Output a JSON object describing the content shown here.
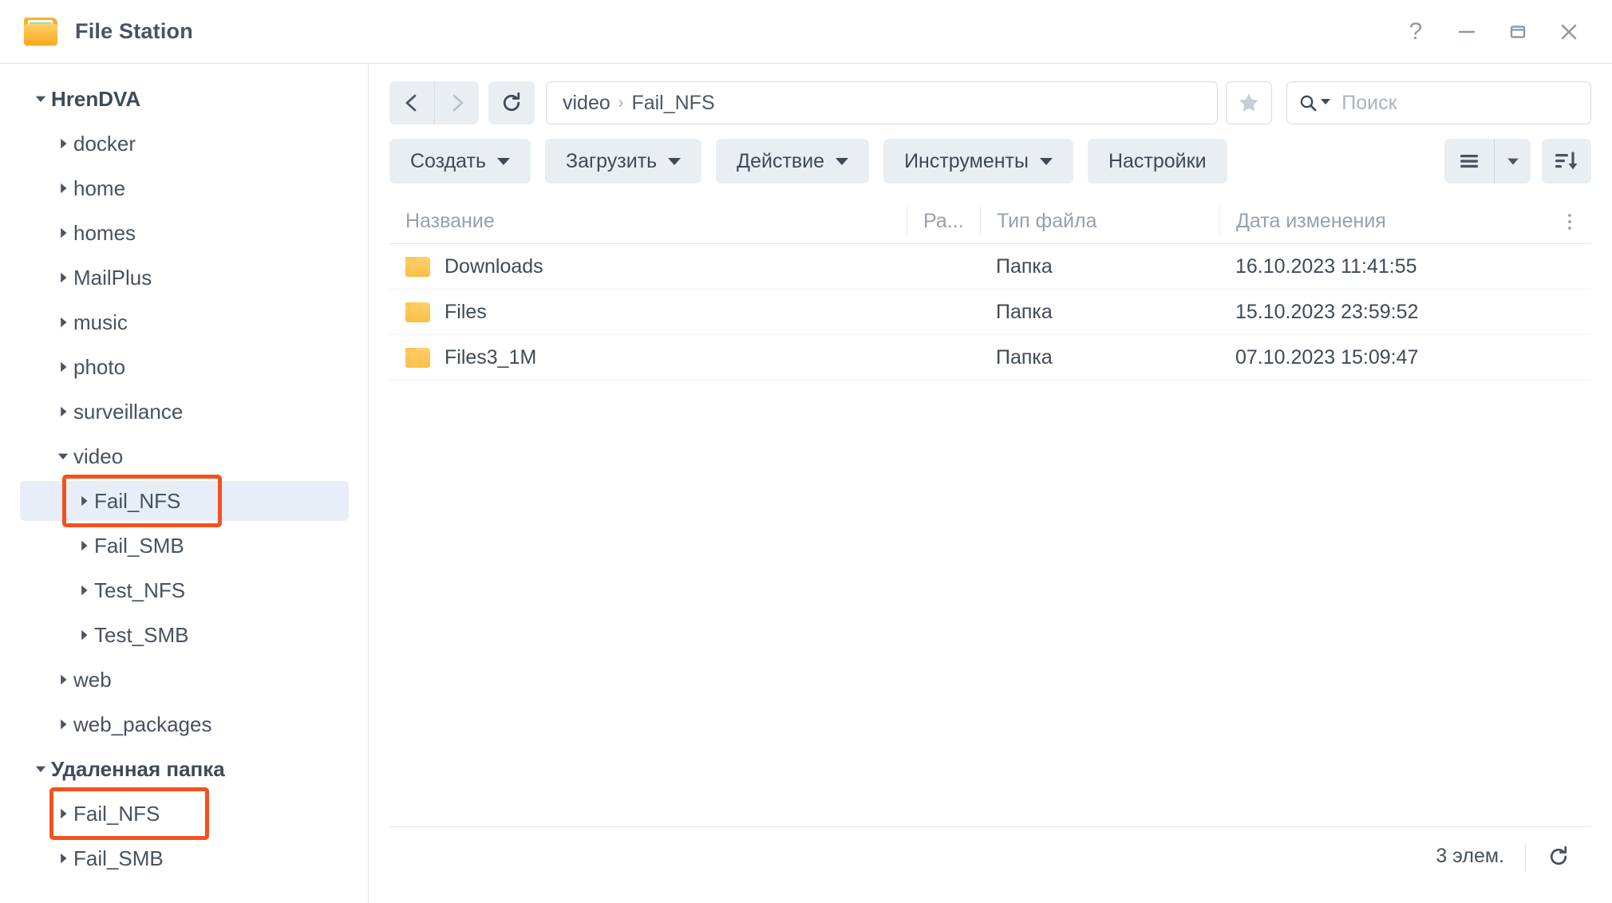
{
  "window": {
    "title": "File Station",
    "icon": "folder-icon",
    "controls": [
      {
        "name": "help-button",
        "glyph": "?"
      },
      {
        "name": "minimize-button",
        "glyph": "—"
      },
      {
        "name": "maximize-button",
        "glyph": "□"
      },
      {
        "name": "close-button",
        "glyph": "✕"
      }
    ]
  },
  "sidebar": {
    "items": [
      {
        "label": "HrenDVA",
        "level": 0,
        "expanded": true,
        "caret": "caret-down",
        "bold": true,
        "selected": false,
        "annotated": false
      },
      {
        "label": "docker",
        "level": 1,
        "expanded": false,
        "caret": "caret-right",
        "bold": false,
        "selected": false,
        "annotated": false
      },
      {
        "label": "home",
        "level": 1,
        "expanded": false,
        "caret": "caret-right",
        "bold": false,
        "selected": false,
        "annotated": false
      },
      {
        "label": "homes",
        "level": 1,
        "expanded": false,
        "caret": "caret-right",
        "bold": false,
        "selected": false,
        "annotated": false
      },
      {
        "label": "MailPlus",
        "level": 1,
        "expanded": false,
        "caret": "caret-right",
        "bold": false,
        "selected": false,
        "annotated": false
      },
      {
        "label": "music",
        "level": 1,
        "expanded": false,
        "caret": "caret-right",
        "bold": false,
        "selected": false,
        "annotated": false
      },
      {
        "label": "photo",
        "level": 1,
        "expanded": false,
        "caret": "caret-right",
        "bold": false,
        "selected": false,
        "annotated": false
      },
      {
        "label": "surveillance",
        "level": 1,
        "expanded": false,
        "caret": "caret-right",
        "bold": false,
        "selected": false,
        "annotated": false
      },
      {
        "label": "video",
        "level": 1,
        "expanded": true,
        "caret": "caret-down",
        "bold": false,
        "selected": false,
        "annotated": false
      },
      {
        "label": "Fail_NFS",
        "level": 2,
        "expanded": false,
        "caret": "caret-right",
        "bold": false,
        "selected": true,
        "annotated": true
      },
      {
        "label": "Fail_SMB",
        "level": 2,
        "expanded": false,
        "caret": "caret-right",
        "bold": false,
        "selected": false,
        "annotated": false
      },
      {
        "label": "Test_NFS",
        "level": 2,
        "expanded": false,
        "caret": "caret-right",
        "bold": false,
        "selected": false,
        "annotated": false
      },
      {
        "label": "Test_SMB",
        "level": 2,
        "expanded": false,
        "caret": "caret-right",
        "bold": false,
        "selected": false,
        "annotated": false
      },
      {
        "label": "web",
        "level": 1,
        "expanded": false,
        "caret": "caret-right",
        "bold": false,
        "selected": false,
        "annotated": false
      },
      {
        "label": "web_packages",
        "level": 1,
        "expanded": false,
        "caret": "caret-right",
        "bold": false,
        "selected": false,
        "annotated": false
      },
      {
        "label": "Удаленная папка",
        "level": 0,
        "expanded": true,
        "caret": "caret-down",
        "bold": true,
        "selected": false,
        "annotated": false
      },
      {
        "label": "Fail_NFS",
        "level": 1,
        "expanded": false,
        "caret": "caret-right",
        "bold": false,
        "selected": false,
        "annotated": true
      },
      {
        "label": "Fail_SMB",
        "level": 1,
        "expanded": false,
        "caret": "caret-right",
        "bold": false,
        "selected": false,
        "annotated": false
      }
    ]
  },
  "nav": {
    "back": "back-arrow",
    "forward": "forward-arrow",
    "refresh": "refresh-icon",
    "breadcrumb": [
      "video",
      "Fail_NFS"
    ],
    "breadcrumb_separator": "›",
    "favorite": "star-icon"
  },
  "search": {
    "placeholder": "Поиск",
    "value": "",
    "icon": "search-icon",
    "dropdown": "chevron-down-icon"
  },
  "toolbar": {
    "create_label": "Создать",
    "upload_label": "Загрузить",
    "action_label": "Действие",
    "tools_label": "Инструменты",
    "settings_label": "Настройки",
    "view_mode_icon": "list-view-icon",
    "view_mode_caret": "chevron-down-icon",
    "sort_icon": "sort-descending-icon"
  },
  "table": {
    "columns": {
      "name": "Название",
      "size": "Ра...",
      "type": "Тип файла",
      "date": "Дата изменения"
    },
    "column_menu_icon": "more-vertical-icon",
    "rows": [
      {
        "name": "Downloads",
        "size": "",
        "type": "Папка",
        "date": "16.10.2023 11:41:55",
        "icon": "folder-icon"
      },
      {
        "name": "Files",
        "size": "",
        "type": "Папка",
        "date": "15.10.2023 23:59:52",
        "icon": "folder-icon"
      },
      {
        "name": "Files3_1M",
        "size": "",
        "type": "Папка",
        "date": "07.10.2023 15:09:47",
        "icon": "folder-icon"
      }
    ]
  },
  "statusbar": {
    "count_label": "3 элем.",
    "refresh_icon": "refresh-icon"
  },
  "colors": {
    "accent_folder": "#f6b93b",
    "selection": "#e7eef8",
    "annotation": "#f4511e",
    "text": "#47525f",
    "muted": "#97a0ab",
    "button_bg": "#e9eef3"
  }
}
